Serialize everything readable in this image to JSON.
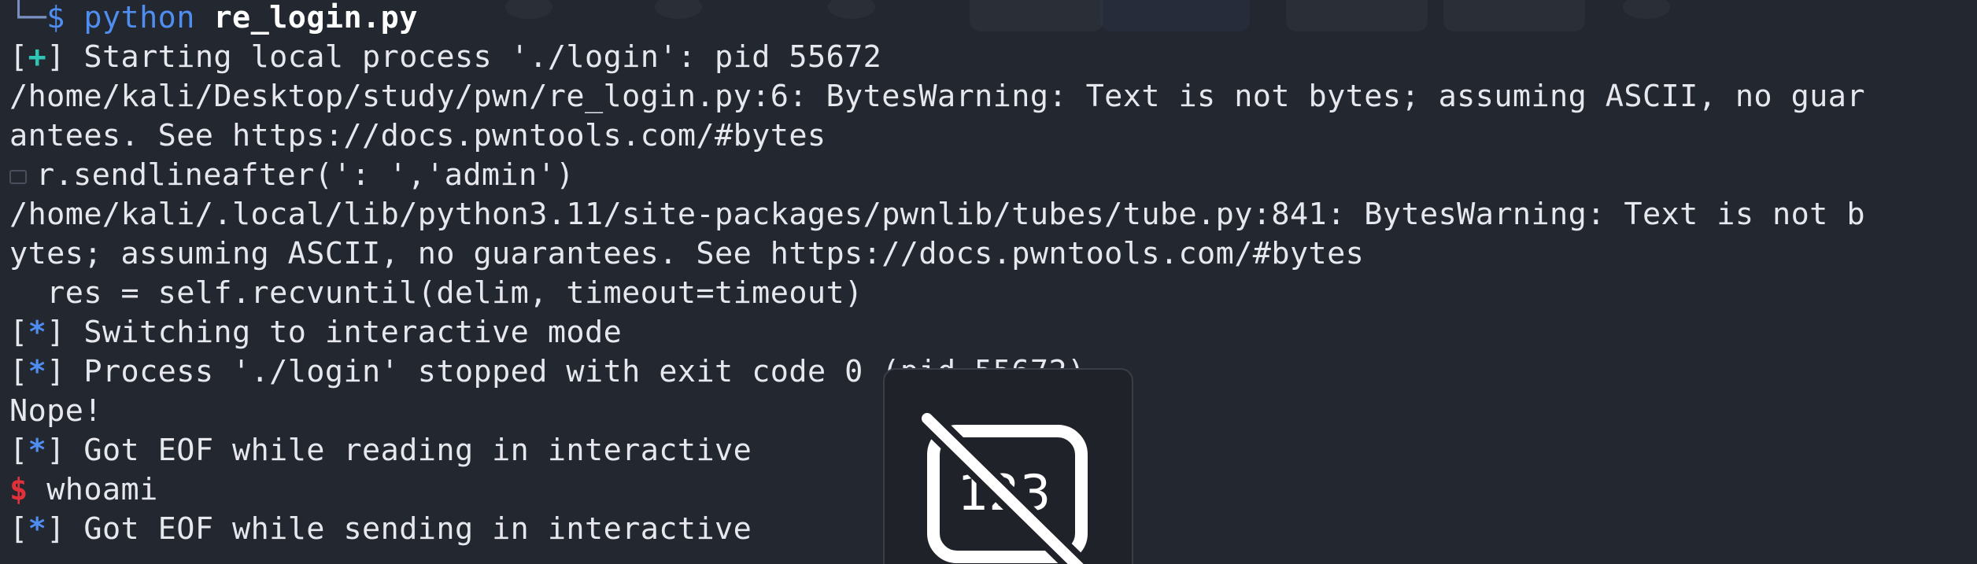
{
  "terminal": {
    "prompt": {
      "tree": "└─",
      "dollar": "$",
      "command": "python",
      "argument": "re_login.py"
    },
    "lines": [
      {
        "marker": "+",
        "text": "Starting local process './login': pid 55672"
      },
      {
        "text": "/home/kali/Desktop/study/pwn/re_login.py:6: BytesWarning: Text is not bytes; assuming ASCII, no guar"
      },
      {
        "text": "antees. See https://docs.pwntools.com/#bytes"
      },
      {
        "text": "r.sendlineafter(': ','admin')"
      },
      {
        "text": "/home/kali/.local/lib/python3.11/site-packages/pwnlib/tubes/tube.py:841: BytesWarning: Text is not b"
      },
      {
        "text": "ytes; assuming ASCII, no guarantees. See https://docs.pwntools.com/#bytes"
      },
      {
        "text": "  res = self.recvuntil(delim, timeout=timeout)"
      },
      {
        "marker": "*",
        "text": "Switching to interactive mode"
      },
      {
        "marker": "*",
        "text": "Process './login' stopped with exit code 0 (pid 55672)"
      },
      {
        "text": "Nope!"
      },
      {
        "marker": "*",
        "text": "Got EOF while reading in interactive"
      },
      {
        "dollar": "$",
        "text": "whoami"
      },
      {
        "marker": "*",
        "text": "Got EOF while sending in interactive"
      }
    ]
  },
  "overlay": {
    "icon": "numeric-keypad-disabled-icon",
    "label": "123"
  },
  "colors": {
    "background": "#23272f",
    "text": "#e6e8ee",
    "blue": "#4f8ef0",
    "cyan": "#2ec4b6",
    "red": "#e0313a"
  }
}
